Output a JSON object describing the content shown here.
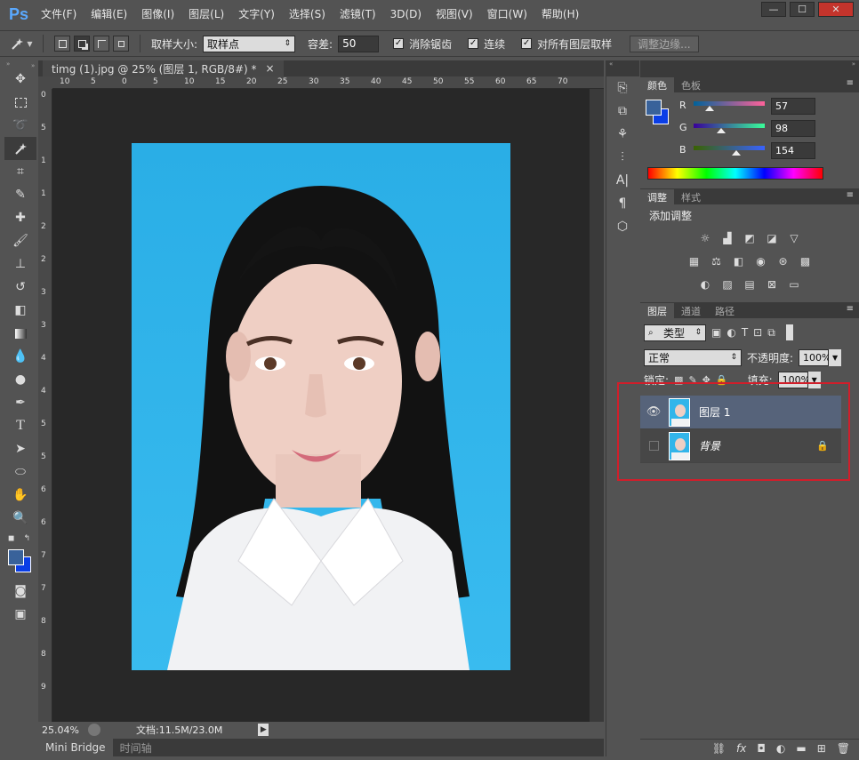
{
  "menubar": {
    "logo": "Ps",
    "items": [
      "文件(F)",
      "编辑(E)",
      "图像(I)",
      "图层(L)",
      "文字(Y)",
      "选择(S)",
      "滤镜(T)",
      "3D(D)",
      "视图(V)",
      "窗口(W)",
      "帮助(H)"
    ],
    "window_controls": [
      "—",
      "☐",
      "✕"
    ]
  },
  "options": {
    "tool_icon": "magic-wand-icon",
    "sample_size_label": "取样大小:",
    "sample_size_value": "取样点",
    "tolerance_label": "容差:",
    "tolerance_value": "50",
    "antialias_label": "消除锯齿",
    "contiguous_label": "连续",
    "sample_all_label": "对所有图层取样",
    "refine_edge_label": "调整边缘..."
  },
  "document": {
    "tab_title": "timg (1).jpg @ 25% (图层 1, RGB/8#) *",
    "tab_close": "×",
    "ruler_h": [
      "10",
      "5",
      "0",
      "5",
      "10",
      "15",
      "20",
      "25",
      "30",
      "35",
      "40",
      "45",
      "50",
      "55",
      "60",
      "65",
      "70"
    ],
    "ruler_v": [
      "0",
      "5",
      "1",
      "1",
      "2",
      "2",
      "3",
      "3",
      "4",
      "4",
      "5",
      "5",
      "6",
      "6",
      "7",
      "7",
      "8",
      "8",
      "9"
    ],
    "zoom": "25.04%",
    "doc_size": "文档:11.5M/23.0M"
  },
  "bottom_tabs": [
    "Mini Bridge",
    "时间轴"
  ],
  "color_panel": {
    "tabs": [
      "颜色",
      "色板"
    ],
    "r_label": "R",
    "r_value": "57",
    "g_label": "G",
    "g_value": "98",
    "b_label": "B",
    "b_value": "154",
    "fg_color": "#39629a",
    "bg_color": "#0a3ee6"
  },
  "adjust_panel": {
    "tabs": [
      "调整",
      "样式"
    ],
    "title": "添加调整"
  },
  "layers_panel": {
    "tabs": [
      "图层",
      "通道",
      "路径"
    ],
    "filter_kind": "类型",
    "blend_mode": "正常",
    "opacity_label": "不透明度:",
    "opacity_value": "100%",
    "lock_label": "锁定:",
    "fill_label": "填充:",
    "fill_value": "100%",
    "layers": [
      {
        "name": "图层 1",
        "visible": true,
        "selected": true
      },
      {
        "name": "背景",
        "visible": false,
        "selected": false,
        "locked": true
      }
    ]
  }
}
